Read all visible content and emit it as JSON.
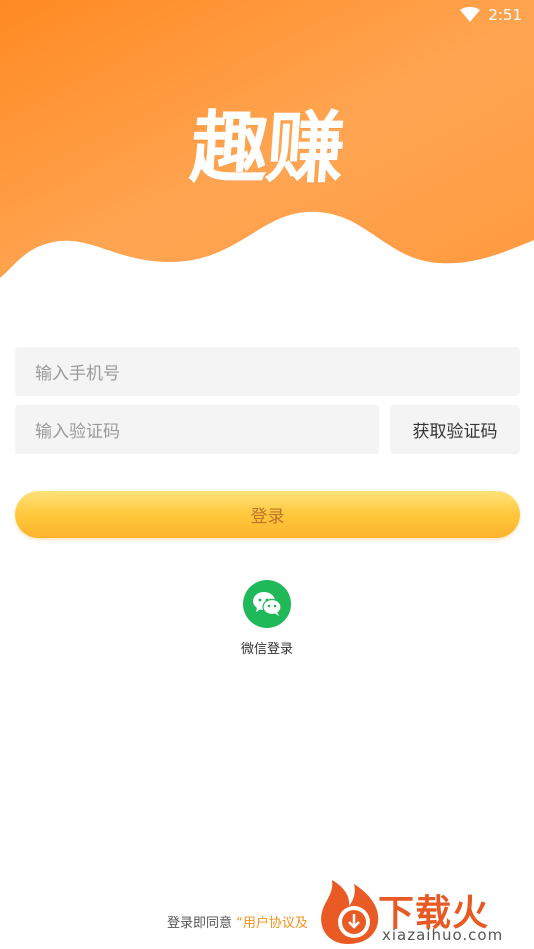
{
  "status_bar": {
    "time": "2:51",
    "icons": [
      "wifi-icon"
    ]
  },
  "app": {
    "logo_text": "趣赚"
  },
  "form": {
    "phone_placeholder": "输入手机号",
    "code_placeholder": "输入验证码",
    "get_code_label": "获取验证码",
    "login_label": "登录"
  },
  "wechat": {
    "label": "微信登录",
    "icon": "wechat-icon"
  },
  "agreement": {
    "prefix": "登录即同意",
    "link": "“用户协议及"
  },
  "watermark": {
    "brand": "下载火",
    "domain": "xiazaihuo.com"
  },
  "colors": {
    "header_top": "#ff8a22",
    "header_bottom": "#ffb060",
    "login_button": "#ffc83d",
    "login_text": "#c0722a",
    "wechat_green": "#1fb95a",
    "field_bg": "#f4f4f4"
  }
}
